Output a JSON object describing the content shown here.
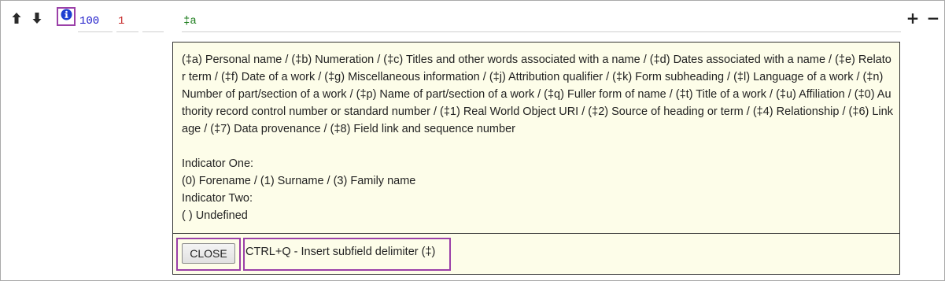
{
  "row": {
    "tag": "100",
    "indicator1": "1",
    "indicator2": "",
    "content": "‡a",
    "icons": {
      "move_up": "arrow-up-icon",
      "move_down": "arrow-down-icon",
      "info": "info-circle-icon",
      "add": "plus-icon",
      "remove": "minus-icon"
    }
  },
  "help": {
    "subfields": "(‡a) Personal name / (‡b) Numeration / (‡c) Titles and other words associated with a name / (‡d) Dates associated with a name / (‡e) Relator term / (‡f) Date of a work / (‡g) Miscellaneous information / (‡j) Attribution qualifier / (‡k) Form subheading / (‡l) Language of a work / (‡n) Number of part/section of a work / (‡p) Name of part/section of a work / (‡q) Fuller form of name / (‡t) Title of a work / (‡u) Affiliation / (‡0) Authority record control number or standard number / (‡1) Real World Object URI / (‡2) Source of heading or term / (‡4) Relationship / (‡6) Linkage / (‡7) Data provenance / (‡8) Field link and sequence number",
    "indicator_one_label": "Indicator One:",
    "indicator_one_values": "(0) Forename / (1) Surname / (3) Family name",
    "indicator_two_label": "Indicator Two:",
    "indicator_two_values": "( ) Undefined",
    "close_label": "CLOSE",
    "shortcut_hint": "CTRL+Q - Insert subfield delimiter (‡)"
  },
  "colors": {
    "tag": "#1a17c9",
    "indicator": "#c62828",
    "content": "#1e7e1e",
    "help_background": "#fdfde9",
    "highlight": "#9b40a8",
    "info_icon": "#1d3fd1"
  }
}
